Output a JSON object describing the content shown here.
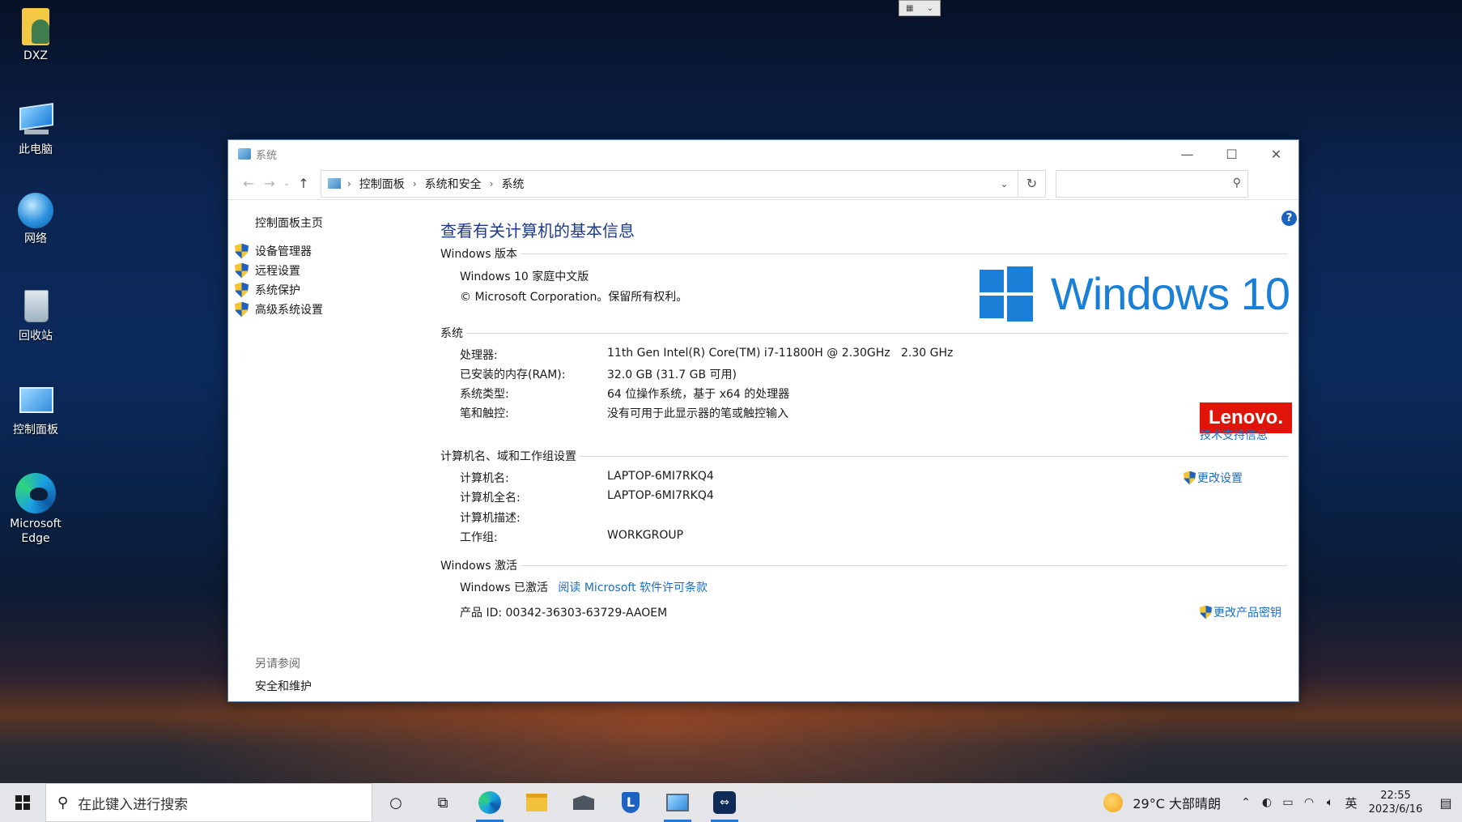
{
  "desktop": {
    "icons": [
      {
        "label": "DXZ"
      },
      {
        "label": "此电脑"
      },
      {
        "label": "网络"
      },
      {
        "label": "回收站"
      },
      {
        "label": "控制面板"
      },
      {
        "label": "Microsoft Edge"
      }
    ]
  },
  "window": {
    "title": "系统",
    "breadcrumb": [
      "控制面板",
      "系统和安全",
      "系统"
    ],
    "search_placeholder": "",
    "left_pane": {
      "home": "控制面板主页",
      "links": [
        "设备管理器",
        "远程设置",
        "系统保护",
        "高级系统设置"
      ],
      "see_also_label": "另请参阅",
      "see_also_links": [
        "安全和维护"
      ]
    },
    "main": {
      "page_title": "查看有关计算机的基本信息",
      "windows_edition": {
        "heading": "Windows 版本",
        "edition": "Windows 10 家庭中文版",
        "copyright": "© Microsoft Corporation。保留所有权利。",
        "logo_text": "Windows 10"
      },
      "system": {
        "heading": "系统",
        "rows": [
          {
            "label": "处理器:",
            "value": "11th Gen Intel(R) Core(TM) i7-11800H @ 2.30GHz   2.30 GHz"
          },
          {
            "label": "已安装的内存(RAM):",
            "value": "32.0 GB (31.7 GB 可用)"
          },
          {
            "label": "系统类型:",
            "value": "64 位操作系统，基于 x64 的处理器"
          },
          {
            "label": "笔和触控:",
            "value": "没有可用于此显示器的笔或触控输入"
          }
        ],
        "oem_logo": "Lenovo.",
        "support_link": "技术支持信息"
      },
      "computer_name": {
        "heading": "计算机名、域和工作组设置",
        "rows": [
          {
            "label": "计算机名:",
            "value": "LAPTOP-6MI7RKQ4"
          },
          {
            "label": "计算机全名:",
            "value": "LAPTOP-6MI7RKQ4"
          },
          {
            "label": "计算机描述:",
            "value": ""
          },
          {
            "label": "工作组:",
            "value": "WORKGROUP"
          }
        ],
        "change_settings": "更改设置"
      },
      "activation": {
        "heading": "Windows 激活",
        "status": "Windows 已激活",
        "license_link": "阅读 Microsoft 软件许可条款",
        "product_id": "产品 ID: 00342-36303-63729-AAOEM",
        "change_key": "更改产品密钥"
      }
    }
  },
  "taskbar": {
    "search_placeholder": "在此键入进行搜索",
    "weather": "29°C  大部晴朗",
    "ime": "英",
    "time": "22:55",
    "date": "2023/6/16"
  },
  "colors": {
    "accent": "#1a7fd6",
    "link": "#1a6fc4",
    "title": "#1e3a8a",
    "lenovo_red": "#e1140a"
  }
}
